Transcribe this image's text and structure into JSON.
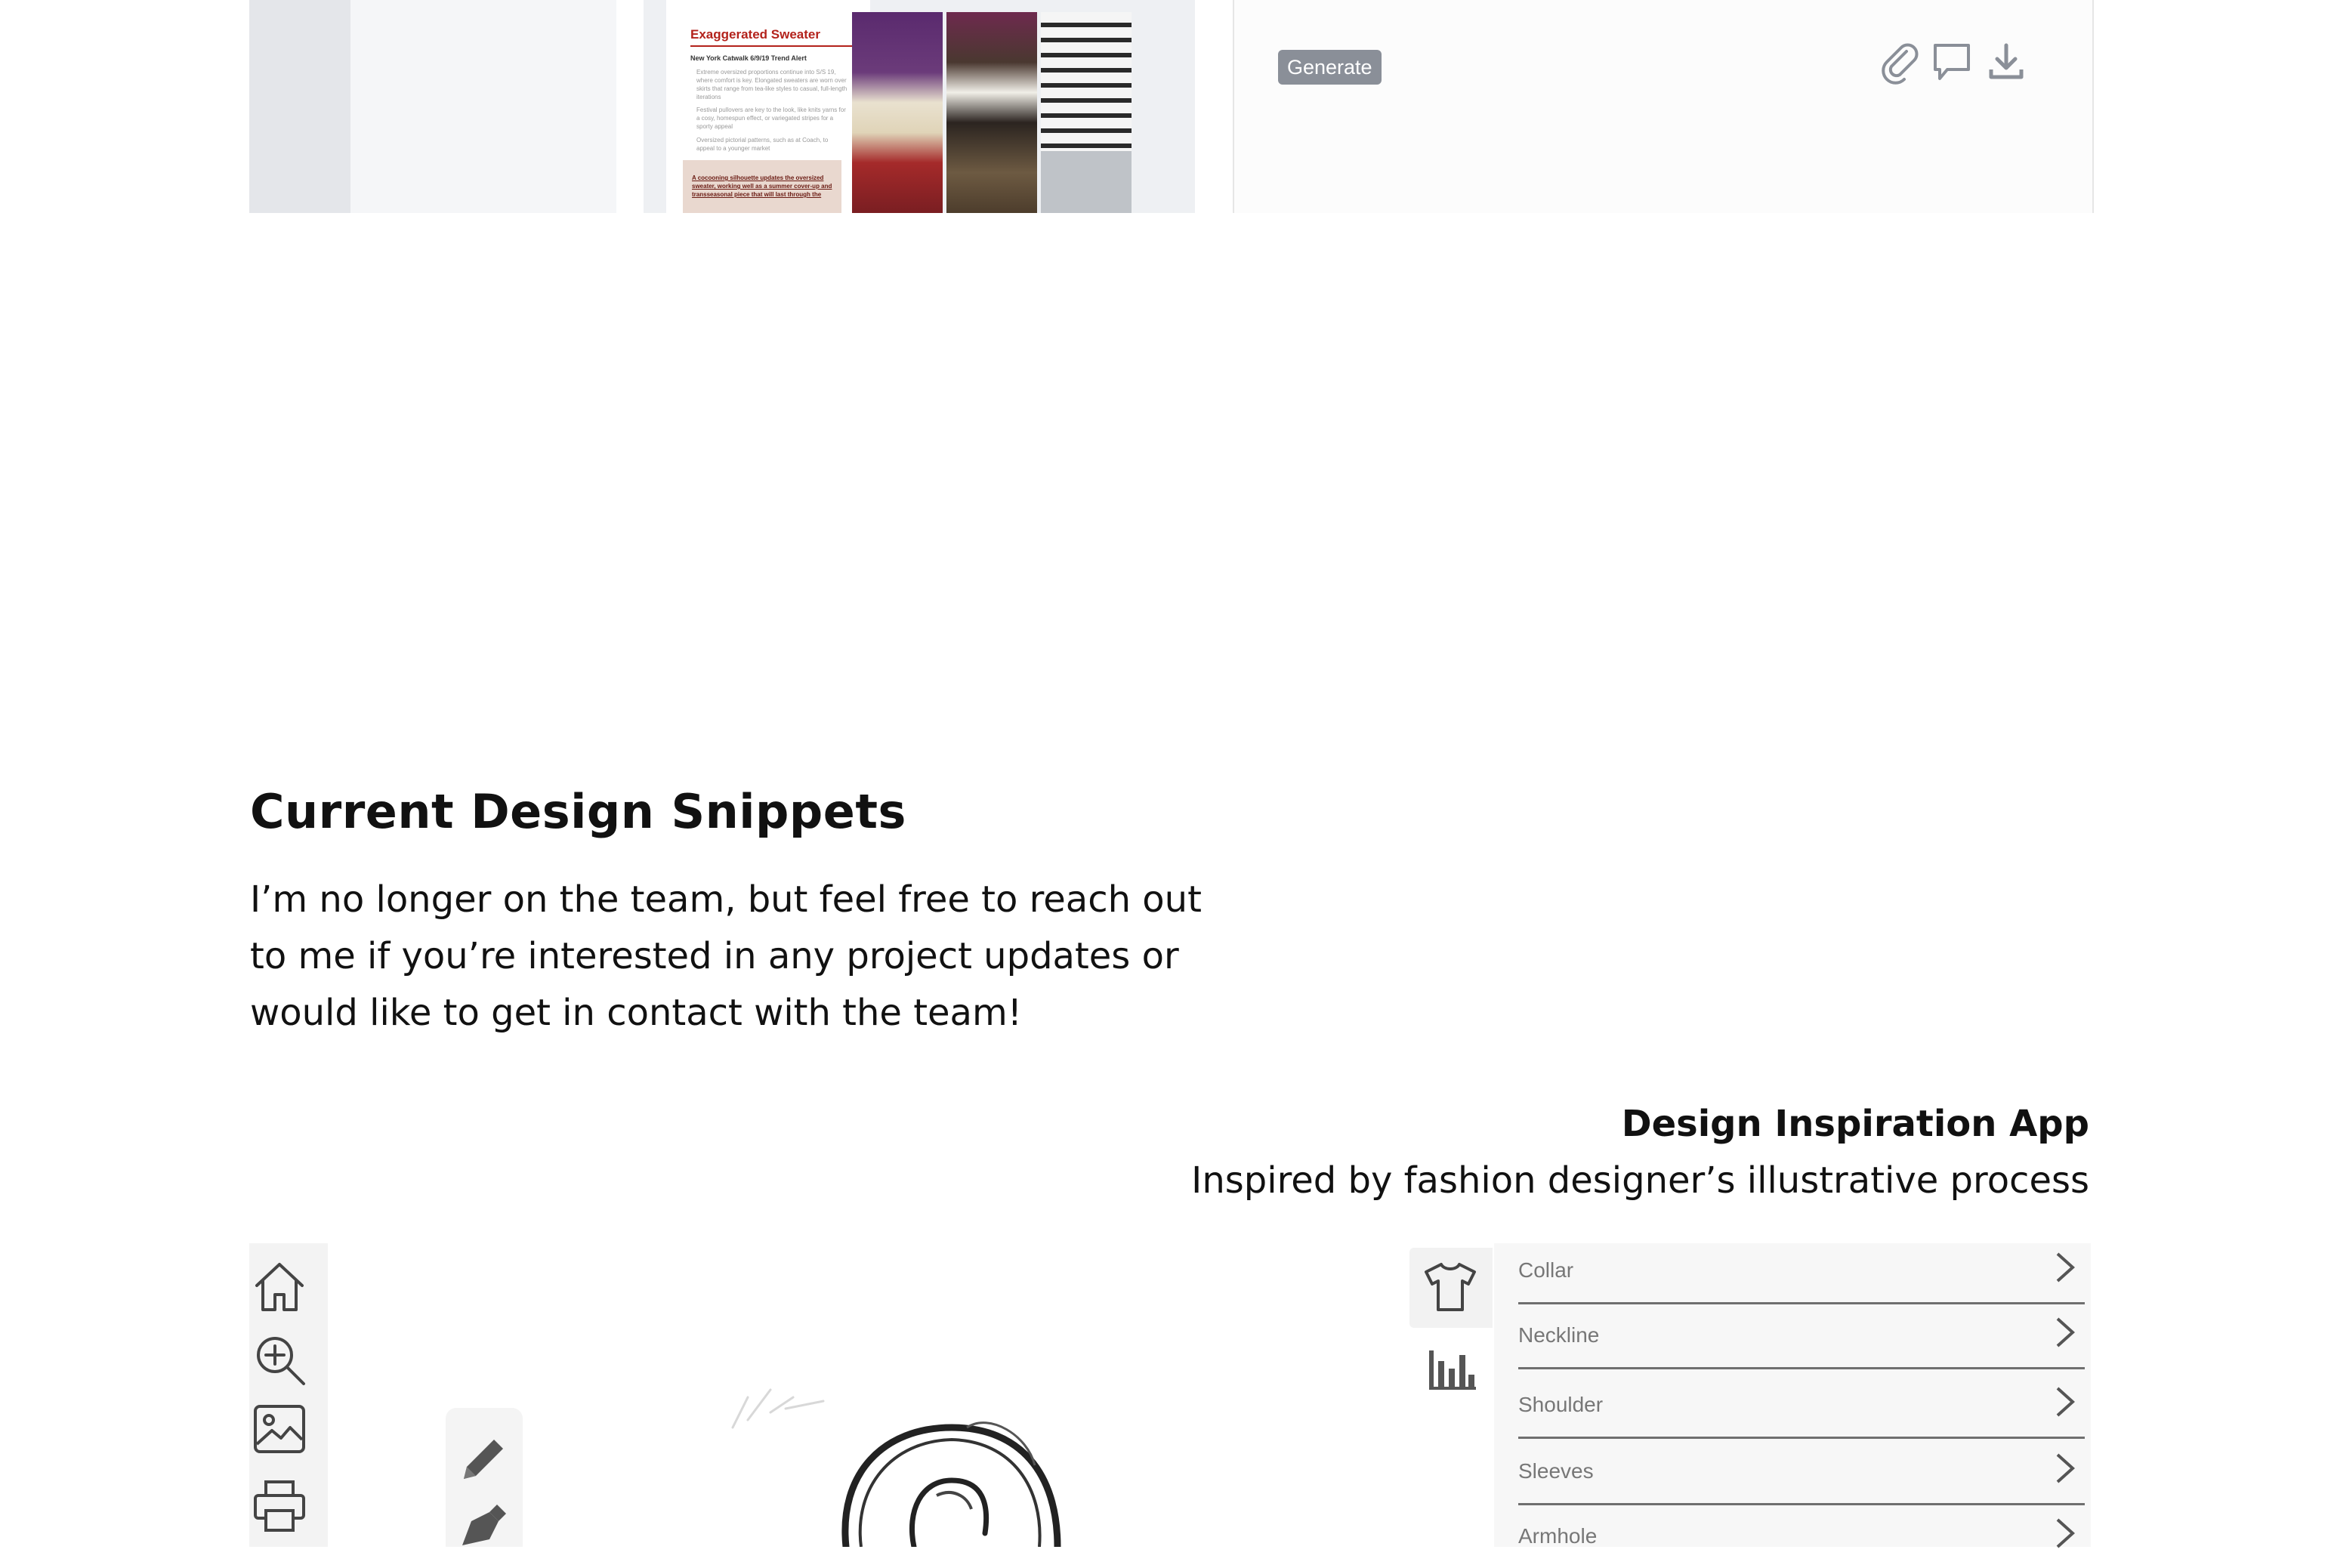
{
  "top_strip": {
    "doc_card": {
      "title": "Exaggerated Sweater",
      "subtitle": "New York Catwalk 6/9/19 Trend Alert",
      "bullets": [
        "Extreme oversized proportions continue into S/S 19, where comfort is key. Elongated sweaters are worn over skirts that range from tea-like styles to casual, full-length iterations",
        "Festival pullovers are key to the look, like knits yarns for a cosy, homespun effect, or variegated stripes for a sporty appeal",
        "Oversized pictorial patterns, such as at Coach, to appeal to a younger market"
      ],
      "quote": "A cocooning silhouette updates the oversized sweater, working well as a summer cover-up and transseasonal piece that will last through the"
    },
    "generate_panel": {
      "generate_label": "Generate",
      "icons": [
        "paperclip-icon",
        "comment-icon",
        "download-icon"
      ]
    }
  },
  "section": {
    "title": "Current Design Snippets",
    "body": "I’m no longer on the team, but feel free to reach out to me if you’re interested in any project updates or would like to get in contact with the team!"
  },
  "app": {
    "title": "Design Inspiration App",
    "subtitle": "Inspired by fashion designer’s illustrative process",
    "sidebar_icons": [
      "shirt-icon",
      "bar-chart-icon"
    ],
    "options": [
      {
        "label": "Collar"
      },
      {
        "label": "Neckline"
      },
      {
        "label": "Shoulder"
      },
      {
        "label": "Sleeves"
      },
      {
        "label": "Armhole"
      }
    ]
  },
  "sketch_app": {
    "tool_icons": [
      "home-icon",
      "zoom-in-icon",
      "image-icon",
      "print-icon"
    ],
    "palette_icons": [
      "pencil-icon",
      "pen-nib-icon"
    ]
  },
  "colors": {
    "accent_red": "#b3221b",
    "generate_button": "#8a8f98",
    "panel_bg": "#f7f7f7"
  }
}
